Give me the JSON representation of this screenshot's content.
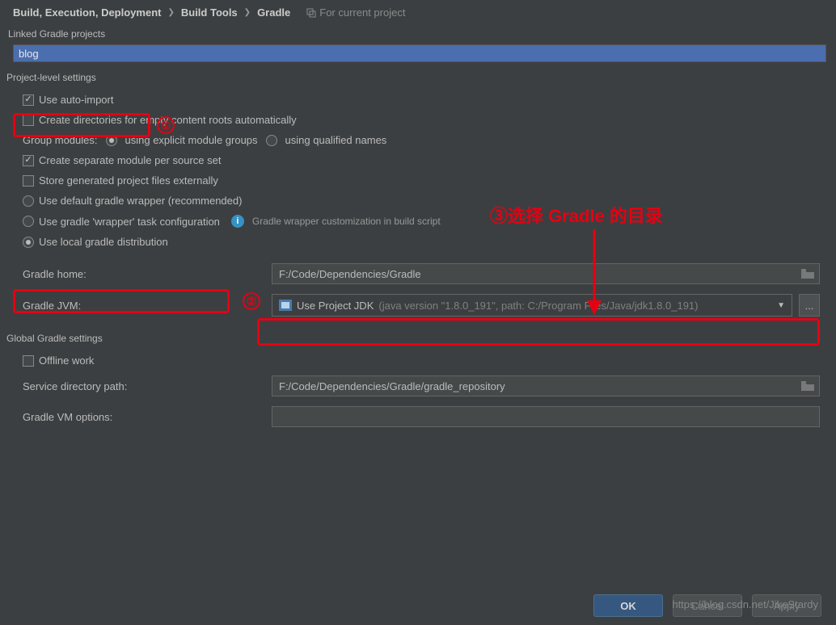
{
  "breadcrumb": {
    "seg1": "Build, Execution, Deployment",
    "seg2": "Build Tools",
    "seg3": "Gradle",
    "scope": "For current project"
  },
  "sections": {
    "linked": "Linked Gradle projects",
    "project_level": "Project-level settings",
    "global": "Global Gradle settings"
  },
  "projects": {
    "item0": "blog"
  },
  "options": {
    "auto_import": "Use auto-import",
    "create_dirs": "Create directories for empty content roots automatically",
    "group_modules_label": "Group modules:",
    "group_explicit": "using explicit module groups",
    "group_qualified": "using qualified names",
    "separate_module": "Create separate module per source set",
    "store_external": "Store generated project files externally",
    "default_wrapper": "Use default gradle wrapper (recommended)",
    "wrapper_task": "Use gradle 'wrapper' task configuration",
    "wrapper_info": "Gradle wrapper customization in build script",
    "local_dist": "Use local gradle distribution",
    "offline_work": "Offline work"
  },
  "fields": {
    "gradle_home_label": "Gradle home:",
    "gradle_home_value": "F:/Code/Dependencies/Gradle",
    "gradle_jvm_label": "Gradle JVM:",
    "gradle_jvm_main": "Use Project JDK",
    "gradle_jvm_detail": "(java version \"1.8.0_191\", path: C:/Program Files/Java/jdk1.8.0_191)",
    "service_dir_label": "Service directory path:",
    "service_dir_value": "F:/Code/Dependencies/Gradle/gradle_repository",
    "vm_options_label": "Gradle VM options:",
    "vm_options_value": ""
  },
  "buttons": {
    "ok": "OK",
    "cancel": "Cancel",
    "apply": "Apply",
    "ellipsis": "..."
  },
  "annotations": {
    "n1": "①",
    "n2": "②",
    "text3": "③选择 Gradle 的目录"
  },
  "watermark": "https://blog.csdn.net/JikeStardy"
}
